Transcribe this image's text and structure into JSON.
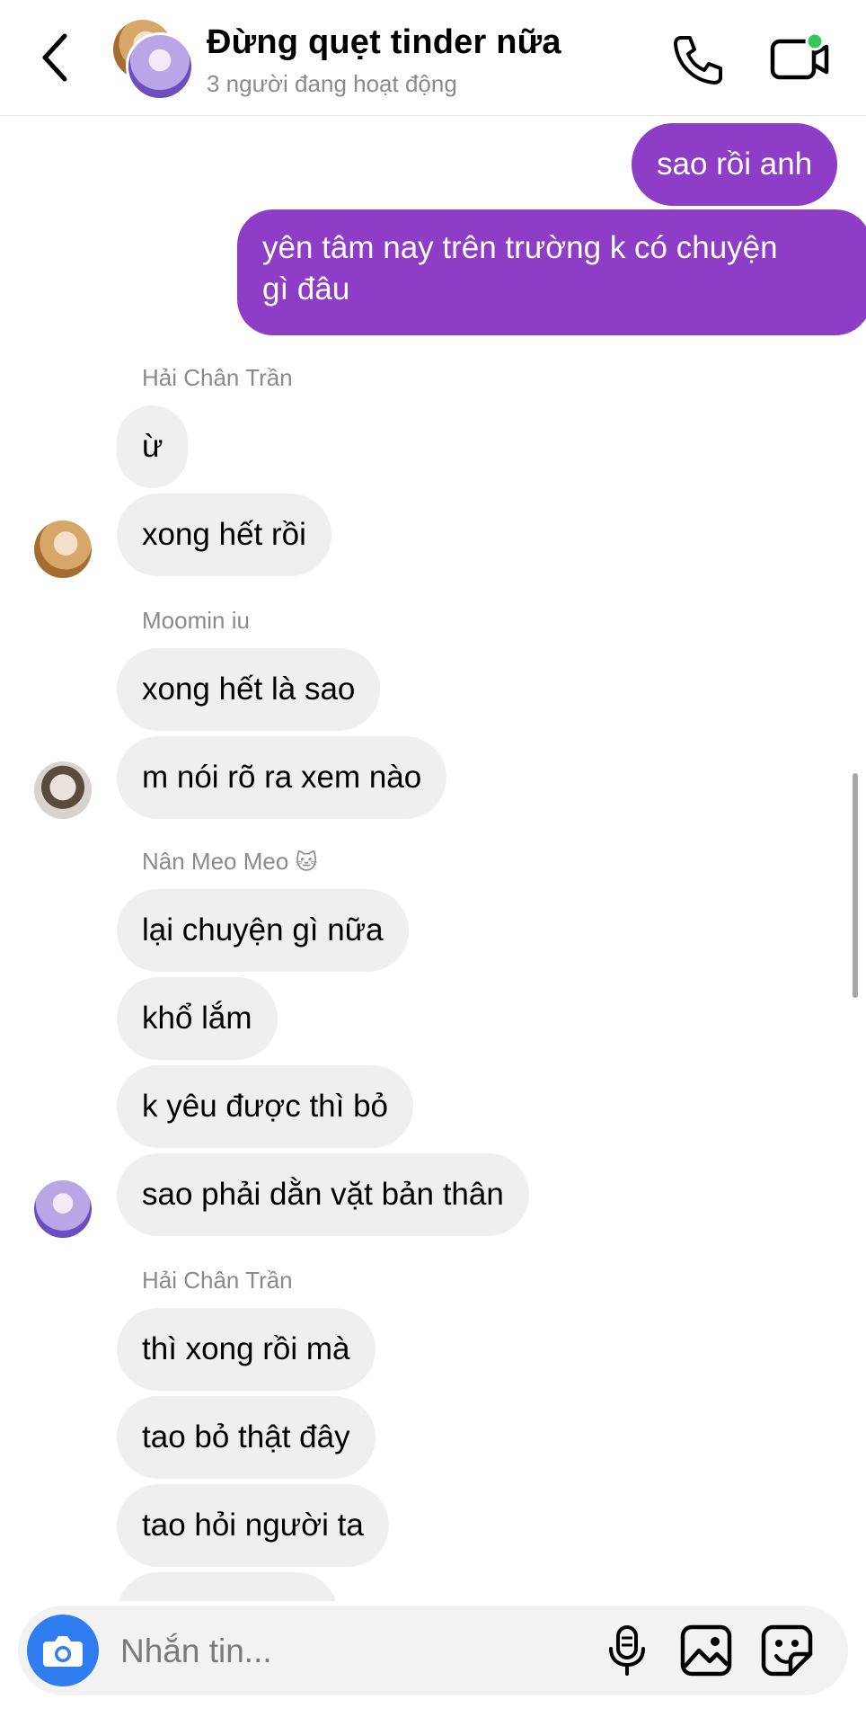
{
  "header": {
    "title": "Đừng quẹt tinder nữa",
    "subtitle": "3 người đang hoạt động",
    "icons": {
      "back": "chevron-left-icon",
      "call": "phone-icon",
      "video": "video-camera-icon"
    },
    "active_dot_color": "#34c759"
  },
  "messages": {
    "out": [
      "sao rồi anh",
      "yên tâm nay trên trường k có chuyện",
      "gì đâu"
    ],
    "group1": {
      "sender": "Hải Chân Trần",
      "items": [
        "ừ",
        "xong hết rồi"
      ]
    },
    "group2": {
      "sender": "Moomin iu",
      "items": [
        "xong hết là sao",
        "m nói rõ ra xem nào"
      ]
    },
    "group3": {
      "sender": "Nân Meo Meo",
      "sender_emoji": "🐱",
      "items": [
        "lại chuyện gì nữa",
        "khổ lắm",
        "k yêu được thì bỏ",
        "sao phải dằn vặt bản thân"
      ]
    },
    "group4": {
      "sender": "Hải Chân Trần",
      "items": [
        "thì xong rồi mà",
        "tao bỏ thật đây",
        "tao hỏi người ta"
      ]
    }
  },
  "colors": {
    "outgoing_bubble": "#8e3dc6",
    "incoming_bubble": "#efefef",
    "camera_button": "#2f7df0"
  },
  "composer": {
    "placeholder": "Nhắn tin...",
    "icons": {
      "camera": "camera-icon",
      "mic": "microphone-icon",
      "gallery": "image-icon",
      "sticker": "sticker-icon"
    }
  }
}
